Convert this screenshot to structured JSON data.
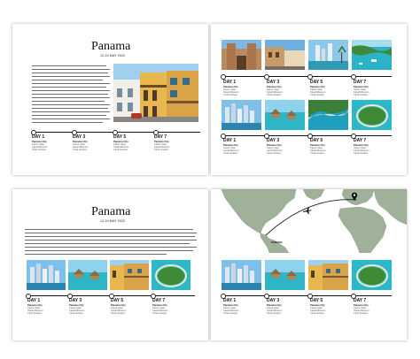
{
  "spreads": {
    "top": {
      "title": "Panama",
      "date": "12-24 MAY 2022",
      "days": [
        {
          "label": "DAY 1",
          "place": "Panama City",
          "notes": [
            "Casco Viejo",
            "Canal Museum",
            "Cinta Costera"
          ]
        },
        {
          "label": "DAY 3",
          "place": "Panama City",
          "notes": [
            "Casco Viejo",
            "Canal Museum",
            "Cinta Costera"
          ]
        },
        {
          "label": "DAY 5",
          "place": "Panama City",
          "notes": [
            "Casco Viejo",
            "Canal Museum",
            "Cinta Costera"
          ]
        },
        {
          "label": "DAY 7",
          "place": "Panama City",
          "notes": [
            "Casco Viejo",
            "Canal Museum",
            "Cinta Costera"
          ]
        }
      ],
      "right_days_top": [
        {
          "label": "DAY 1",
          "place": "Panama City",
          "notes": [
            "Casco Viejo",
            "Canal Museum",
            "Cinta Costera"
          ]
        },
        {
          "label": "DAY 3",
          "place": "Panama City",
          "notes": [
            "Casco Viejo",
            "Canal Museum",
            "Cinta Costera"
          ]
        },
        {
          "label": "DAY 5",
          "place": "Panama City",
          "notes": [
            "Casco Viejo",
            "Canal Museum",
            "Cinta Costera"
          ]
        },
        {
          "label": "DAY 7",
          "place": "Panama City",
          "notes": [
            "Casco Viejo",
            "Canal Museum",
            "Cinta Costera"
          ]
        }
      ],
      "right_days_bottom": [
        {
          "label": "DAY 1",
          "place": "Panama City",
          "notes": [
            "Casco Viejo",
            "Canal Museum",
            "Cinta Costera"
          ]
        },
        {
          "label": "DAY 3",
          "place": "Panama City",
          "notes": [
            "Casco Viejo",
            "Canal Museum",
            "Cinta Costera"
          ]
        },
        {
          "label": "DAY 5",
          "place": "Panama City",
          "notes": [
            "Casco Viejo",
            "Canal Museum",
            "Cinta Costera"
          ]
        },
        {
          "label": "DAY 7",
          "place": "Panama City",
          "notes": [
            "Casco Viejo",
            "Canal Museum",
            "Cinta Costera"
          ]
        }
      ]
    },
    "bottom": {
      "title": "Panama",
      "date": "12-24 MAY 2022",
      "days": [
        {
          "label": "DAY 1",
          "place": "Panama City",
          "notes": [
            "Casco Viejo",
            "Canal Museum",
            "Cinta Costera"
          ]
        },
        {
          "label": "DAY 3",
          "place": "Panama City",
          "notes": [
            "Casco Viejo",
            "Canal Museum",
            "Cinta Costera"
          ]
        },
        {
          "label": "DAY 5",
          "place": "Panama City",
          "notes": [
            "Casco Viejo",
            "Canal Museum",
            "Cinta Costera"
          ]
        },
        {
          "label": "DAY 7",
          "place": "Panama City",
          "notes": [
            "Casco Viejo",
            "Canal Museum",
            "Cinta Costera"
          ]
        }
      ],
      "map_label": "PANAMA",
      "right_days": [
        {
          "label": "DAY 1",
          "place": "Panama City",
          "notes": [
            "Casco Viejo",
            "Canal Museum",
            "Cinta Costera"
          ]
        },
        {
          "label": "DAY 3",
          "place": "Panama City",
          "notes": [
            "Casco Viejo",
            "Canal Museum",
            "Cinta Costera"
          ]
        },
        {
          "label": "DAY 5",
          "place": "Panama City",
          "notes": [
            "Casco Viejo",
            "Canal Museum",
            "Cinta Costera"
          ]
        },
        {
          "label": "DAY 7",
          "place": "Panama City",
          "notes": [
            "Casco Viejo",
            "Canal Museum",
            "Cinta Costera"
          ]
        }
      ]
    }
  },
  "colors": {
    "map_land": "#9fb198",
    "map_sea": "#ffffff",
    "route": "#1a1a1a",
    "timeline": "#111111"
  },
  "icons": {
    "route_plane": "airplane-icon",
    "map_pin": "map-pin-icon"
  }
}
